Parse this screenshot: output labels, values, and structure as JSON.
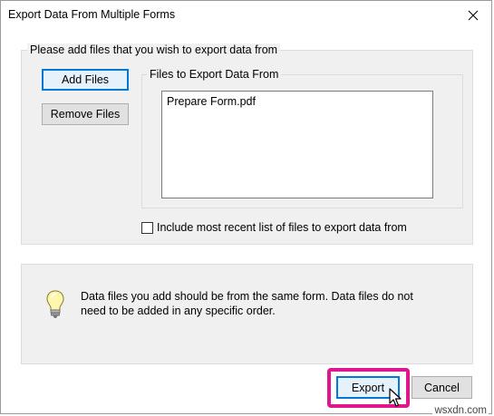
{
  "window": {
    "title": "Export Data From Multiple Forms"
  },
  "files_group": {
    "caption": "Please add files that you wish to export data from",
    "add_files_label": "Add Files",
    "remove_files_label": "Remove Files",
    "list_caption": "Files to Export Data From",
    "files": [
      "Prepare Form.pdf"
    ]
  },
  "include_recent": {
    "label": "Include most recent list of files to export data from",
    "checked": false
  },
  "info": {
    "icon": "lightbulb-icon",
    "text_line1": "Data files you add should be from the same form. Data files do not",
    "text_line2": "need to be added in any specific order."
  },
  "footer": {
    "export_label": "Export",
    "cancel_label": "Cancel"
  },
  "watermark": "wsxdn.com",
  "colors": {
    "focus": "#0078d7",
    "highlight": "#e0168f"
  }
}
